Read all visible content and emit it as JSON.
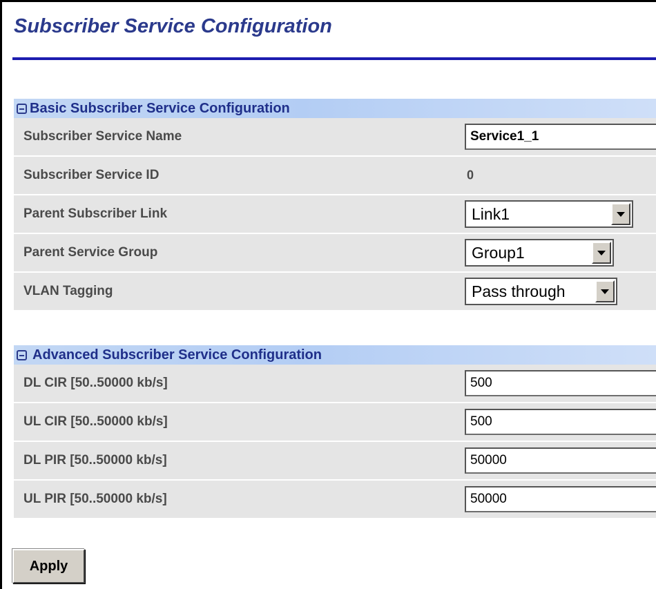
{
  "page": {
    "title": "Subscriber Service Configuration"
  },
  "basic": {
    "header": "Basic Subscriber Service Configuration",
    "service_name_label": "Subscriber Service Name",
    "service_name_value": "Service1_1",
    "service_id_label": "Subscriber Service ID",
    "service_id_value": "0",
    "parent_link_label": "Parent Subscriber Link",
    "parent_link_value": "Link1",
    "parent_group_label": "Parent Service Group",
    "parent_group_value": "Group1",
    "vlan_label": "VLAN Tagging",
    "vlan_value": "Pass through"
  },
  "advanced": {
    "header": "Advanced Subscriber Service Configuration",
    "dl_cir_label": "DL CIR [50..50000 kb/s]",
    "dl_cir_value": "500",
    "ul_cir_label": "UL CIR [50..50000 kb/s]",
    "ul_cir_value": "500",
    "dl_pir_label": "DL PIR [50..50000 kb/s]",
    "dl_pir_value": "50000",
    "ul_pir_label": "UL PIR [50..50000 kb/s]",
    "ul_pir_value": "50000"
  },
  "actions": {
    "apply_label": "Apply"
  },
  "colors": {
    "title": "#2b3a8c",
    "rule": "#1d1daf",
    "row_bg": "#e5e5e5",
    "header_bg": "#b3cdf4"
  }
}
